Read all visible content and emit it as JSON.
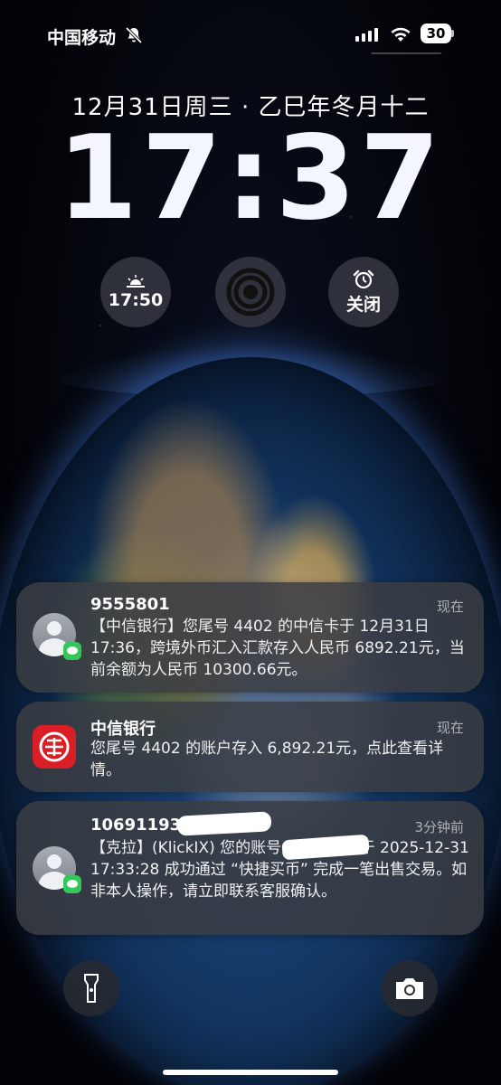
{
  "status_bar": {
    "carrier": "中国移动",
    "battery_level": "30",
    "icons": [
      "bell-muted-icon",
      "cellular-signal-icon",
      "wifi-icon",
      "battery-icon"
    ]
  },
  "lockscreen": {
    "date": "12月31日周三 · 乙巳年冬月十二",
    "time": "17:37"
  },
  "widgets": [
    {
      "icon": "sunset-icon",
      "label": "17:50"
    },
    {
      "icon": "focus-rings-icon",
      "label": ""
    },
    {
      "icon": "alarm-clock-icon",
      "label": "关闭"
    }
  ],
  "notifications": [
    {
      "sender": "9555801",
      "time": "现在",
      "body": "【中信银行】您尾号 4402 的中信卡于 12月31日17:36，跨境外币汇入汇款存入人民币 6892.21元，当前余额为人民币 10300.66元。",
      "icon": "contact-avatar-icon"
    },
    {
      "sender": "中信银行",
      "time": "现在",
      "body": "您尾号 4402 的账户存入 6,892.21元，点此查看详情。",
      "icon": "citic-logo-icon"
    },
    {
      "sender": "1069119302",
      "time": "3分钟前",
      "body": "【克拉】(KlickIX) 您的账号 8200214 于 2025-12-31 17:33:28 成功通过 “快捷买币” 完成一笔出售交易。如非本人操作，请立即联系客服确认。",
      "icon": "contact-avatar-icon"
    }
  ],
  "bottom": {
    "left_icon": "flashlight-icon",
    "right_icon": "camera-icon"
  }
}
